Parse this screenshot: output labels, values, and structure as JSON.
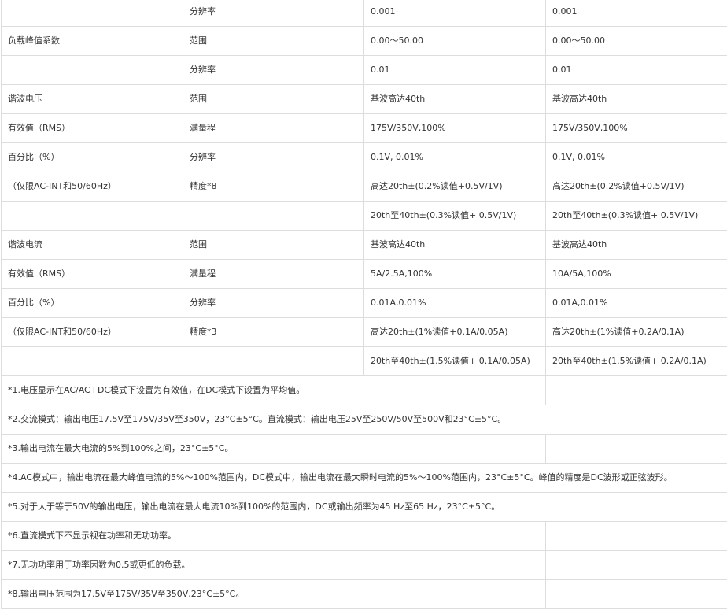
{
  "spec_rows": [
    [
      "",
      "分辨率",
      "0.001",
      "0.001"
    ],
    [
      "负载峰值系数",
      "范围",
      "0.00～50.00",
      "0.00～50.00"
    ],
    [
      "",
      "分辨率",
      "0.01",
      "0.01"
    ],
    [
      "谐波电压",
      "范围",
      "基波高达40th",
      "基波高达40th"
    ],
    [
      "有效值（RMS）",
      "满量程",
      "175V/350V,100%",
      "175V/350V,100%"
    ],
    [
      "百分比（%）",
      "分辨率",
      "0.1V, 0.01%",
      "0.1V, 0.01%"
    ],
    [
      "（仅限AC-INT和50/60Hz）",
      "精度*8",
      "高达20th±(0.2%读值+0.5V/1V)",
      "高达20th±(0.2%读值+0.5V/1V)"
    ],
    [
      "",
      "",
      "20th至40th±(0.3%读值+ 0.5V/1V)",
      "20th至40th±(0.3%读值+ 0.5V/1V)"
    ],
    [
      "谐波电流",
      "范围",
      "基波高达40th",
      "基波高达40th"
    ],
    [
      "有效值（RMS）",
      "满量程",
      "5A/2.5A,100%",
      "10A/5A,100%"
    ],
    [
      "百分比（%）",
      "分辨率",
      "0.01A,0.01%",
      "0.01A,0.01%"
    ],
    [
      "（仅限AC-INT和50/60Hz）",
      "精度*3",
      "高达20th±(1%读值+0.1A/0.05A)",
      "高达20th±(1%读值+0.2A/0.1A)"
    ],
    [
      "",
      "",
      "20th至40th±(1.5%读值+ 0.1A/0.05A)",
      "20th至40th±(1.5%读值+ 0.2A/0.1A)"
    ]
  ],
  "notes": [
    {
      "text": "*1.电压显示在AC/AC+DC模式下设置为有效值，在DC模式下设置为平均值。",
      "full": false
    },
    {
      "text": "*2.交流模式：输出电压17.5V至175V/35V至350V，23°C±5°C。直流模式：输出电压25V至250V/50V至500V和23°C±5°C。",
      "full": true
    },
    {
      "text": "*3.输出电流在最大电流的5%到100%之间，23°C±5°C。",
      "full": false
    },
    {
      "text": "*4.AC模式中，输出电流在最大峰值电流的5%～100%范围内，DC模式中，输出电流在最大瞬时电流的5%～100%范围内，23°C±5°C。峰值的精度是DC波形或正弦波形。",
      "full": true
    },
    {
      "text": "*5.对于大于等于50V的输出电压，输出电流在最大电流10%到100%的范围内，DC或输出频率为45 Hz至65 Hz，23°C±5°C。",
      "full": true
    },
    {
      "text": "*6.直流模式下不显示视在功率和无功功率。",
      "full": false
    },
    {
      "text": "*7.无功功率用于功率因数为0.5或更低的负载。",
      "full": false
    },
    {
      "text": "*8.输出电压范围为17.5V至175V/35V至350V,23°C±5°C。",
      "full": false
    }
  ]
}
